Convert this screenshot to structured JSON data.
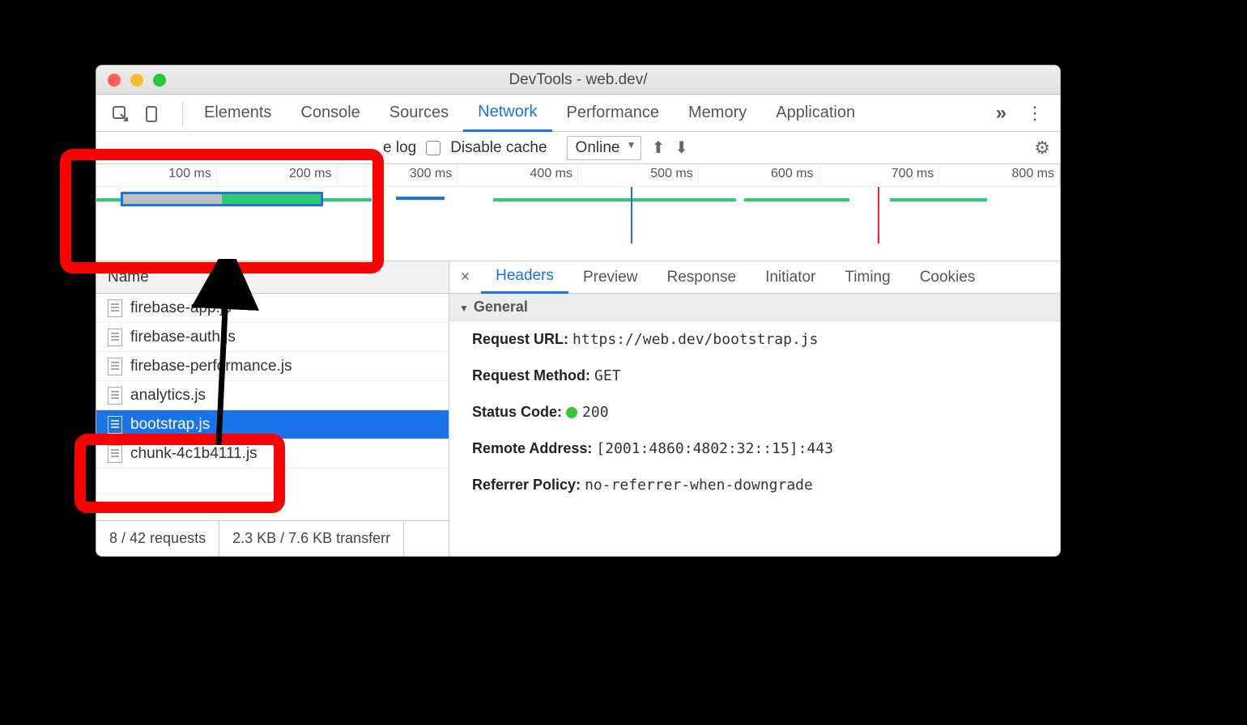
{
  "window": {
    "title": "DevTools - web.dev/"
  },
  "tabs": [
    "Elements",
    "Console",
    "Sources",
    "Network",
    "Performance",
    "Memory",
    "Application"
  ],
  "active_tab": "Network",
  "filterbar": {
    "preserve_log_label": "e log",
    "disable_cache_label": "Disable cache",
    "throttling_value": "Online"
  },
  "timeline_ticks": [
    "100 ms",
    "200 ms",
    "300 ms",
    "400 ms",
    "500 ms",
    "600 ms",
    "700 ms",
    "800 ms"
  ],
  "name_column_header": "Name",
  "files": [
    {
      "name": "firebase-app.js",
      "selected": false
    },
    {
      "name": "firebase-auth.js",
      "selected": false
    },
    {
      "name": "firebase-performance.js",
      "selected": false
    },
    {
      "name": "analytics.js",
      "selected": false
    },
    {
      "name": "bootstrap.js",
      "selected": true
    },
    {
      "name": "chunk-4c1b4111.js",
      "selected": false
    }
  ],
  "status": {
    "requests": "8 / 42 requests",
    "transfer": "2.3 KB / 7.6 KB transferr"
  },
  "detail_tabs": [
    "Headers",
    "Preview",
    "Response",
    "Initiator",
    "Timing",
    "Cookies"
  ],
  "active_detail_tab": "Headers",
  "general_section": {
    "title": "General",
    "request_url_label": "Request URL:",
    "request_url_value": "https://web.dev/bootstrap.js",
    "request_method_label": "Request Method:",
    "request_method_value": "GET",
    "status_code_label": "Status Code:",
    "status_code_value": "200",
    "remote_address_label": "Remote Address:",
    "remote_address_value": "[2001:4860:4802:32::15]:443",
    "referrer_policy_label": "Referrer Policy:",
    "referrer_policy_value": "no-referrer-when-downgrade"
  }
}
